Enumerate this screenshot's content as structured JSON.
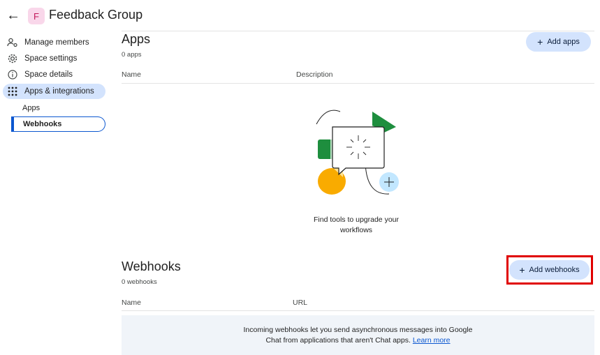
{
  "header": {
    "back_icon": "arrow-back-icon",
    "avatar_letter": "F",
    "title": "Feedback Group"
  },
  "sidebar": {
    "items": [
      {
        "label": "Manage members",
        "icon": "people-settings-icon"
      },
      {
        "label": "Space settings",
        "icon": "gear-icon"
      },
      {
        "label": "Space details",
        "icon": "info-icon"
      },
      {
        "label": "Apps & integrations",
        "icon": "apps-grid-icon"
      }
    ],
    "sub_items": [
      {
        "label": "Apps"
      },
      {
        "label": "Webhooks"
      }
    ]
  },
  "apps": {
    "title": "Apps",
    "count": "0 apps",
    "add_label": "Add apps",
    "col_name": "Name",
    "col_description": "Description",
    "empty_line1": "Find tools to upgrade your",
    "empty_line2": "workflows"
  },
  "webhooks": {
    "title": "Webhooks",
    "count": "0 webhooks",
    "add_label": "Add webhooks",
    "col_name": "Name",
    "col_url": "URL",
    "info_line1": "Incoming webhooks let you send asynchronous messages into Google",
    "info_line2_prefix": "Chat from applications that aren't Chat apps. ",
    "info_link": "Learn more"
  },
  "colors": {
    "accent": "#0b57d0",
    "pill_bg": "#d3e3fd",
    "highlight": "#e00000",
    "info_bg": "#f0f4f9"
  }
}
